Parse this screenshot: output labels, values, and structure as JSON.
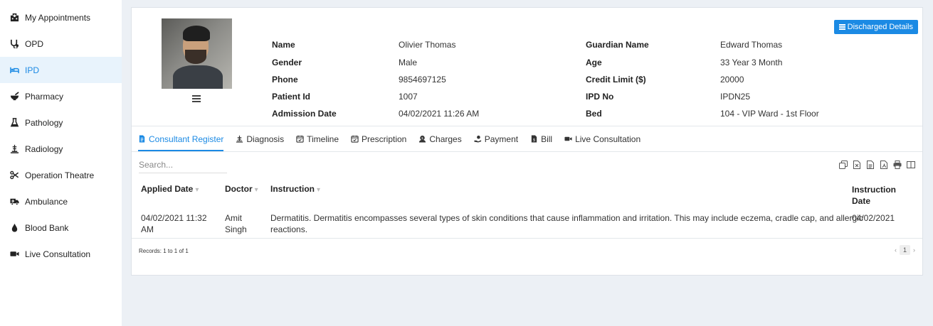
{
  "sidebar": {
    "items": [
      {
        "label": "My Appointments",
        "icon": "hospital-icon"
      },
      {
        "label": "OPD",
        "icon": "stethoscope-icon"
      },
      {
        "label": "IPD",
        "icon": "bed-icon",
        "active": true
      },
      {
        "label": "Pharmacy",
        "icon": "mortar-pestle-icon"
      },
      {
        "label": "Pathology",
        "icon": "flask-icon"
      },
      {
        "label": "Radiology",
        "icon": "xray-icon"
      },
      {
        "label": "Operation Theatre",
        "icon": "scissors-icon"
      },
      {
        "label": "Ambulance",
        "icon": "ambulance-icon"
      },
      {
        "label": "Blood Bank",
        "icon": "blood-drop-icon"
      },
      {
        "label": "Live Consultation",
        "icon": "video-icon"
      }
    ]
  },
  "header": {
    "discharged_button": "Discharged Details"
  },
  "patient": {
    "name_label": "Name",
    "name": "Olivier Thomas",
    "gender_label": "Gender",
    "gender": "Male",
    "phone_label": "Phone",
    "phone": "9854697125",
    "patient_id_label": "Patient Id",
    "patient_id": "1007",
    "admission_label": "Admission Date",
    "admission": "04/02/2021 11:26 AM",
    "guardian_label": "Guardian Name",
    "guardian": "Edward Thomas",
    "age_label": "Age",
    "age": "33 Year 3 Month",
    "credit_label": "Credit Limit ($)",
    "credit": "20000",
    "ipd_label": "IPD No",
    "ipd": "IPDN25",
    "bed_label": "Bed",
    "bed": "104 - VIP Ward - 1st Floor"
  },
  "tabs": [
    {
      "label": "Consultant Register",
      "icon": "register-icon",
      "active": true
    },
    {
      "label": "Diagnosis",
      "icon": "diagnosis-icon"
    },
    {
      "label": "Timeline",
      "icon": "calendar-check-icon"
    },
    {
      "label": "Prescription",
      "icon": "prescription-icon"
    },
    {
      "label": "Charges",
      "icon": "charges-icon"
    },
    {
      "label": "Payment",
      "icon": "payment-icon"
    },
    {
      "label": "Bill",
      "icon": "bill-icon"
    },
    {
      "label": "Live Consultation",
      "icon": "video-icon"
    }
  ],
  "table": {
    "search_placeholder": "Search...",
    "columns": {
      "applied_date": "Applied Date",
      "doctor": "Doctor",
      "instruction": "Instruction",
      "instruction_date_1": "Instruction",
      "instruction_date_2": "Date"
    },
    "rows": [
      {
        "applied_date_1": "04/02/2021 11:32",
        "applied_date_2": "AM",
        "doctor_1": "Amit",
        "doctor_2": "Singh",
        "instruction_1": "Dermatitis. Dermatitis encompasses several types of skin conditions that cause inflammation and irritation. This may include eczema, cradle cap, and allergic",
        "instruction_2": "reactions.",
        "instruction_date": "04/02/2021"
      }
    ],
    "records_text": "Records: 1 to 1 of 1",
    "current_page": "1",
    "prev": "‹",
    "next": "›"
  },
  "colors": {
    "accent": "#1b8ae4",
    "background": "#ecf0f5"
  }
}
